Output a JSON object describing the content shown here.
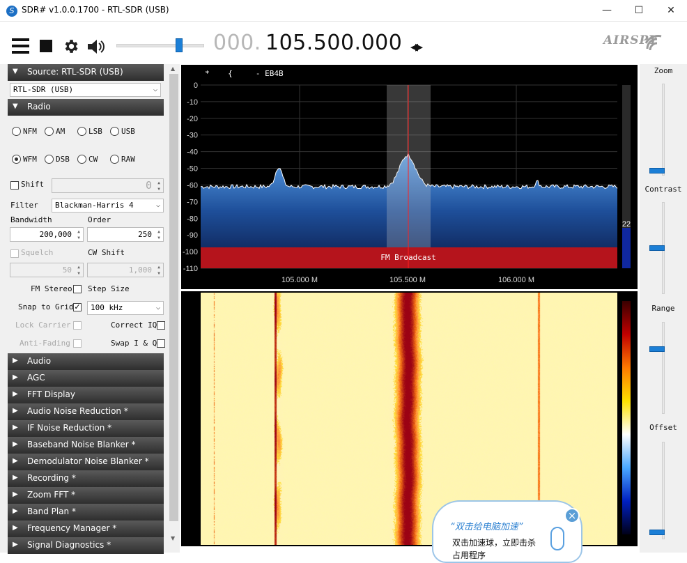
{
  "window": {
    "title": "SDR# v1.0.0.1700 - RTL-SDR (USB)",
    "app_icon_glyph": "S",
    "minimize": "—",
    "maximize": "☐",
    "close": "✕"
  },
  "toolbar": {
    "menu_icon": "hamburger-icon",
    "stop_icon": "stop-icon",
    "settings_icon": "gear-icon",
    "volume_icon": "speaker-icon",
    "volume_level": 0.72,
    "freq_prefix": "000.",
    "freq_main": "105.500.000",
    "freq_arrows": "◂▸",
    "logo": "AIRSPY"
  },
  "source": {
    "header": "Source: RTL-SDR (USB)",
    "device": "RTL-SDR (USB)"
  },
  "radio": {
    "header": "Radio",
    "modes": [
      "NFM",
      "AM",
      "LSB",
      "USB",
      "WFM",
      "DSB",
      "CW",
      "RAW"
    ],
    "selected_mode": "WFM",
    "shift_label": "Shift",
    "shift_value": "0",
    "filter_label": "Filter",
    "filter_value": "Blackman-Harris 4",
    "bandwidth_label": "Bandwidth",
    "bandwidth_value": "200,000",
    "order_label": "Order",
    "order_value": "250",
    "squelch_label": "Squelch",
    "squelch_value": "50",
    "cwshift_label": "CW Shift",
    "cwshift_value": "1,000",
    "fm_stereo_label": "FM Stereo",
    "step_size_label": "Step Size",
    "snap_label": "Snap to Grid",
    "step_value": "100 kHz",
    "lock_carrier_label": "Lock Carrier",
    "correct_iq_label": "Correct IQ",
    "anti_fading_label": "Anti-Fading",
    "swap_iq_label": "Swap I & Q"
  },
  "panels": [
    "Audio",
    "AGC",
    "FFT Display",
    "Audio Noise Reduction *",
    "IF Noise Reduction *",
    "Baseband Noise Blanker *",
    "Demodulator Noise Blanker *",
    "Recording *",
    "Zoom FFT *",
    "Band Plan *",
    "Frequency Manager *",
    "Signal Diagnostics *"
  ],
  "spectrum": {
    "rds_line": "*    {     - EB4B",
    "band_label": "FM Broadcast",
    "y_ticks": [
      "0",
      "-10",
      "-20",
      "-30",
      "-40",
      "-50",
      "-60",
      "-70",
      "-80",
      "-90",
      "-100",
      "-110"
    ],
    "x_ticks": [
      "105.000 M",
      "105.500 M",
      "106.000 M"
    ],
    "snr_value": "22"
  },
  "right": {
    "zoom": "Zoom",
    "contrast": "Contrast",
    "range": "Range",
    "offset": "Offset"
  },
  "popup": {
    "title": "“双击给电脑加速”",
    "line1": "双击加速球，立即击杀",
    "line2": "占用程序",
    "close": "×"
  },
  "colors": {
    "accent": "#1c7fd6",
    "band": "#b5141c",
    "header_dark": "#2e2e2e"
  }
}
